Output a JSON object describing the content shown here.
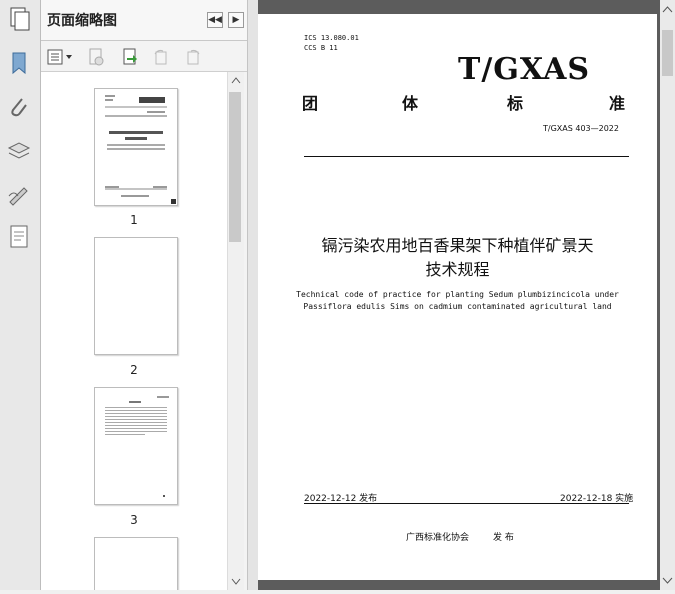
{
  "panel": {
    "title": "页面缩略图",
    "thumbnails": [
      {
        "label": "1"
      },
      {
        "label": "2"
      },
      {
        "label": "3"
      }
    ]
  },
  "document": {
    "ics": "ICS  13.080.01",
    "ccs": "CCS  B 11",
    "logo": "T/GXAS",
    "std_type_chars": [
      "团",
      "体",
      "标",
      "准"
    ],
    "std_number": "T/GXAS 403—2022",
    "title_cn_line1": "镉污染农用地百香果架下种植伴矿景天",
    "title_cn_line2": "技术规程",
    "title_en_line1": "Technical code of practice for planting Sedum plumbizincicola under",
    "title_en_line2": "Passiflora edulis Sims on cadmium contaminated agricultural land",
    "release_date": "2022-12-12 发布",
    "impl_date": "2022-12-18 实施",
    "issuer": "广西标准化协会",
    "issue_word": "发 布"
  }
}
